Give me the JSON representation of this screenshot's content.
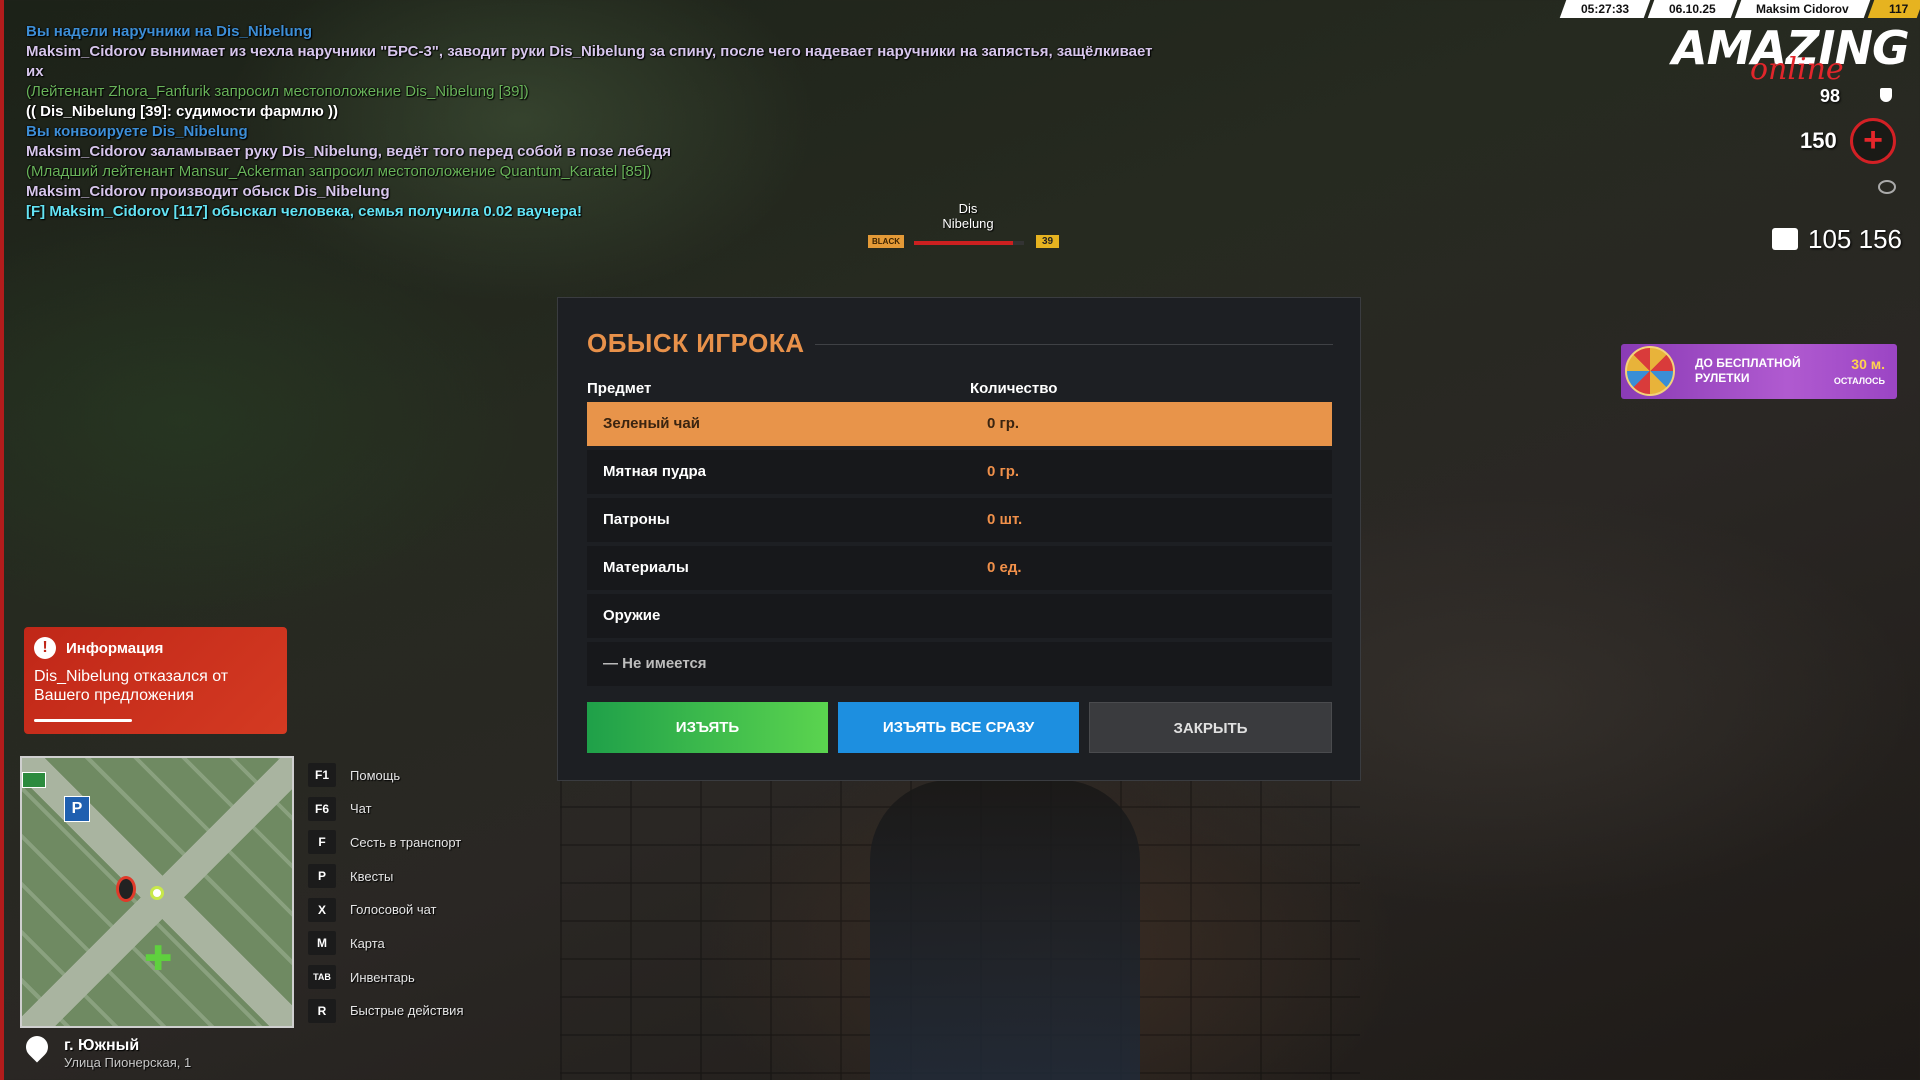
{
  "chat": [
    {
      "style": "c-blue",
      "text": "Вы надели наручники на Dis_Nibelung"
    },
    {
      "style": "c-me wrap",
      "text": "Maksim_Cidorov вынимает из чехла наручники \"БРС-3\", заводит руки Dis_Nibelung за спину, после чего надевает наручники на запястья, защёлкивает их"
    },
    {
      "style": "c-green",
      "text": "(Лейтенант Zhora_Fanfurik запросил местоположение Dis_Nibelung [39])"
    },
    {
      "style": "c-white",
      "text": "(( Dis_Nibelung [39]: судимости фармлю ))"
    },
    {
      "style": "c-blue",
      "text": "Вы конвоируете Dis_Nibelung"
    },
    {
      "style": "c-me",
      "text": "Maksim_Cidorov заламывает руку Dis_Nibelung, ведёт того перед собой в позе лебедя"
    },
    {
      "style": "c-green",
      "text": "(Младший лейтенант Mansur_Ackerman запросил местоположение Quantum_Karatel [85])"
    },
    {
      "style": "c-me",
      "text": "Maksim_Cidorov производит обыск Dis_Nibelung"
    },
    {
      "style": "c-cyan",
      "text": "[F] Maksim_Cidorov [117] обыскал человека, семья получила 0.02 ваучера!"
    }
  ],
  "nameplate": {
    "first": "Dis",
    "last": "Nibelung",
    "tag": "BLACK",
    "level": "39",
    "health": 0.9
  },
  "topbar": {
    "time": "05:27:33",
    "date": "06.10.25",
    "player": "Maksim Cidorov",
    "level": "117"
  },
  "logo": {
    "main": "AMAZING",
    "sub": "online"
  },
  "stats": {
    "armor": "98",
    "health": "150",
    "money": "105 156"
  },
  "roulette": {
    "title": "ДО БЕСПЛАТНОЙ РУЛЕТКИ",
    "time": "30 м.",
    "left": "ОСТАЛОСЬ"
  },
  "info": {
    "title": "Информация",
    "text": "Dis_Nibelung отказался от Вашего предложения"
  },
  "location": {
    "city": "г. Южный",
    "street": "Улица Пионерская, 1"
  },
  "hotkeys": [
    {
      "key": "F1",
      "label": "Помощь"
    },
    {
      "key": "F6",
      "label": "Чат"
    },
    {
      "key": "F",
      "label": "Сесть в транспорт"
    },
    {
      "key": "P",
      "label": "Квесты"
    },
    {
      "key": "X",
      "label": "Голосовой чат"
    },
    {
      "key": "M",
      "label": "Карта"
    },
    {
      "key": "TAB",
      "label": "Инвентарь"
    },
    {
      "key": "R",
      "label": "Быстрые действия"
    }
  ],
  "modal": {
    "title": "ОБЫСК ИГРОКА",
    "col_item": "Предмет",
    "col_qty": "Количество",
    "rows": [
      {
        "item": "Зеленый чай",
        "qty": "0 гр."
      },
      {
        "item": "Мятная пудра",
        "qty": "0 гр."
      },
      {
        "item": "Патроны",
        "qty": "0 шт."
      },
      {
        "item": "Материалы",
        "qty": "0 ед."
      },
      {
        "item": "Оружие",
        "qty": ""
      },
      {
        "item": "— Не имеется",
        "qty": ""
      }
    ],
    "btn_take": "ИЗЪЯТЬ",
    "btn_take_all": "ИЗЪЯТЬ ВСЕ СРАЗУ",
    "btn_close": "ЗАКРЫТЬ"
  }
}
